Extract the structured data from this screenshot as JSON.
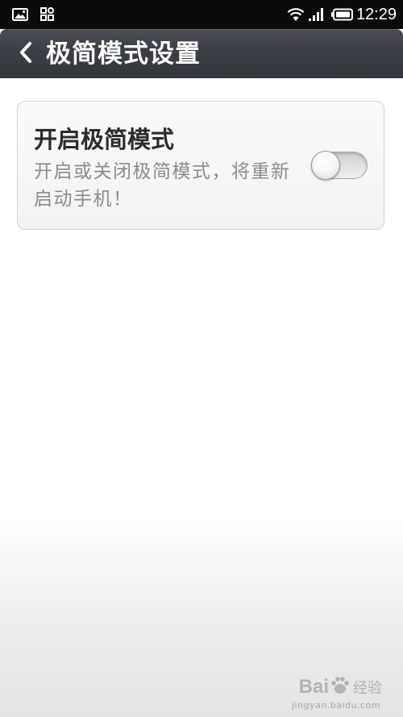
{
  "status_bar": {
    "icons": [
      "picture-icon",
      "apps-grid-icon",
      "wifi-icon",
      "signal-icon",
      "battery-icon"
    ],
    "time": "12:29"
  },
  "header": {
    "back_icon": "chevron-left-icon",
    "title": "极简模式设置"
  },
  "setting": {
    "title": "开启极简模式",
    "description": "开启或关闭极简模式，将重新启动手机！",
    "toggle_on": false
  },
  "watermark": {
    "brand": "Bai",
    "brand_suffix": "经验",
    "url": "jingyan.baidu.com"
  },
  "colors": {
    "title_bar": "#3b3e44",
    "status_bar": "#0b0b0b",
    "card_border": "#d3d3d6",
    "description_text": "#8c8c8c"
  }
}
